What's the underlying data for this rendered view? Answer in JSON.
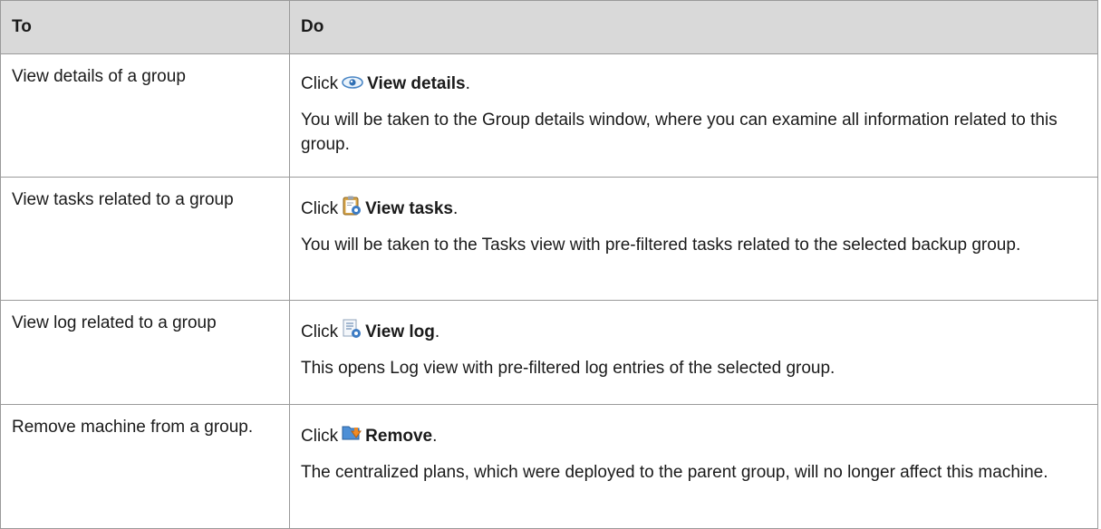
{
  "table": {
    "headers": [
      "To",
      "Do"
    ],
    "rows": [
      {
        "to": "View details of a group",
        "click": "Click",
        "action": "View details",
        "punct": ".",
        "icon": "eye-icon",
        "desc": "You will be taken to the Group details window, where you can examine all information related to this group."
      },
      {
        "to": "View tasks related to a group",
        "click": "Click",
        "action": "View tasks",
        "punct": ".",
        "icon": "tasks-clipboard-icon",
        "desc": "You will be taken to the Tasks view with pre-filtered tasks related to the selected backup group."
      },
      {
        "to": "View log related to a group",
        "click": "Click",
        "action": "View log",
        "punct": ".",
        "icon": "log-document-icon",
        "desc": "This opens Log view with pre-filtered log entries of the selected group."
      },
      {
        "to": "Remove machine from a group.",
        "click": "Click",
        "action": "Remove",
        "punct": ".",
        "icon": "remove-folder-icon",
        "desc": "The centralized plans, which were deployed to the parent group, will no longer affect this machine."
      }
    ]
  }
}
